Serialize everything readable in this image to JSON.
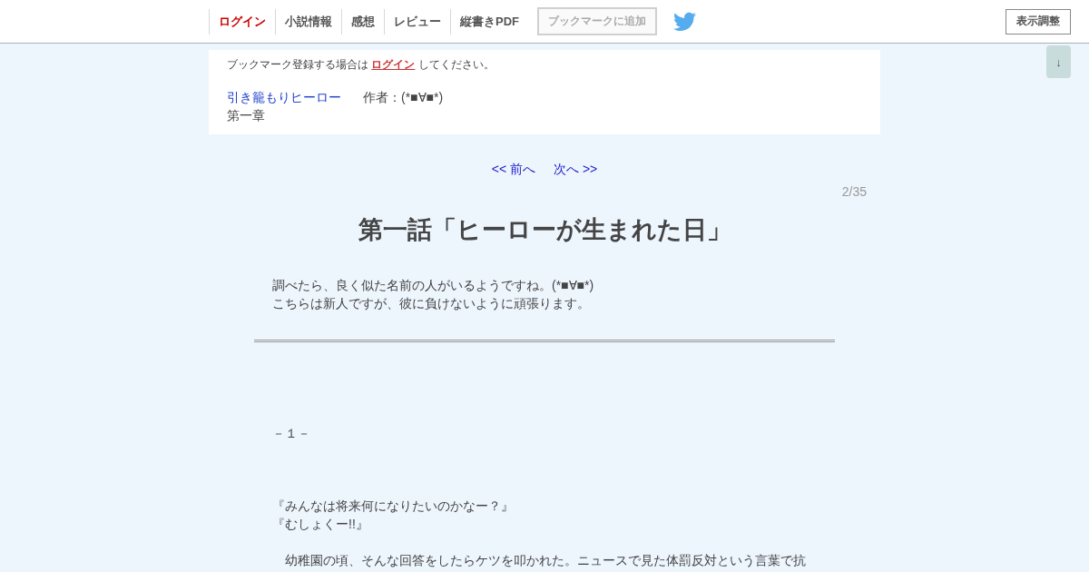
{
  "header": {
    "nav": [
      {
        "label": "ログイン",
        "kind": "login"
      },
      {
        "label": "小説情報",
        "kind": "link"
      },
      {
        "label": "感想",
        "kind": "link"
      },
      {
        "label": "レビュー",
        "kind": "link"
      },
      {
        "label": "縦書きPDF",
        "kind": "link"
      }
    ],
    "bookmark_button": {
      "label": "ブックマークに追加",
      "disabled": true
    },
    "display_settings_button": {
      "label": "表示調整"
    }
  },
  "scroll_button": {
    "label": "↓"
  },
  "info_box": {
    "notice": {
      "before": "ブックマーク登録する場合は",
      "link": "ログイン",
      "after": "してください。"
    },
    "novel_title": "引き籠もりヒーロー",
    "author": "作者：(*■∀■*)",
    "chapter": "第一章"
  },
  "pager": {
    "prev": "<< 前へ",
    "next": "次へ >>"
  },
  "page_count": "2/35",
  "episode_title": "第一話「ヒーローが生まれた日」",
  "preface": [
    "調べたら、良く似た名前の人がいるようですね。(*■∀■*)",
    "こちらは新人ですが、彼に負けないように頑張ります。"
  ],
  "body": [
    {
      "lines": [
        "－１－"
      ]
    },
    {
      "lines": [
        "『みんなは将来何になりたいのかなー？』",
        "『むしょくー!!』"
      ]
    },
    {
      "lines": [
        "　幼稚園の頃、そんな回答をしたらケツを叩かれた。ニュースで見た体罰反対という言葉で抗"
      ]
    }
  ]
}
